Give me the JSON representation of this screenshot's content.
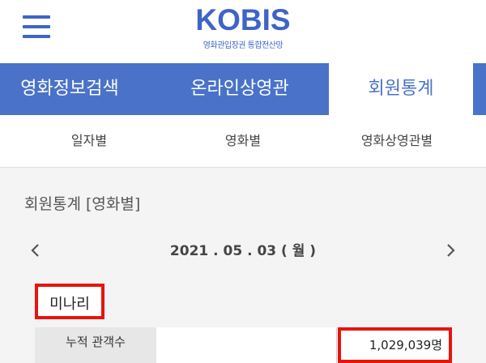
{
  "header": {
    "logo_title": "KOBIS",
    "logo_subtitle": "영화관입장권 통합전산망"
  },
  "nav": {
    "tabs": [
      {
        "label": "영화정보검색"
      },
      {
        "label": "온라인상영관"
      },
      {
        "label": "회원통계"
      }
    ],
    "active_tab": "회원통계"
  },
  "subnav": {
    "tabs": [
      {
        "label": "일자별"
      },
      {
        "label": "영화별"
      },
      {
        "label": "영화상영관별"
      }
    ]
  },
  "content": {
    "section_title": "회원통계 [영화별]",
    "date": "2021 . 05 . 03 ( 월 )",
    "movie_title": "미나리",
    "stat_label": "누적 관객수",
    "stat_value": "1,029,039명"
  },
  "colors": {
    "brand_blue": "#4a72c9",
    "highlight_red": "#e8140c"
  },
  "icons": {
    "menu": "hamburger-icon",
    "prev": "chevron-left-icon",
    "next": "chevron-right-icon"
  }
}
